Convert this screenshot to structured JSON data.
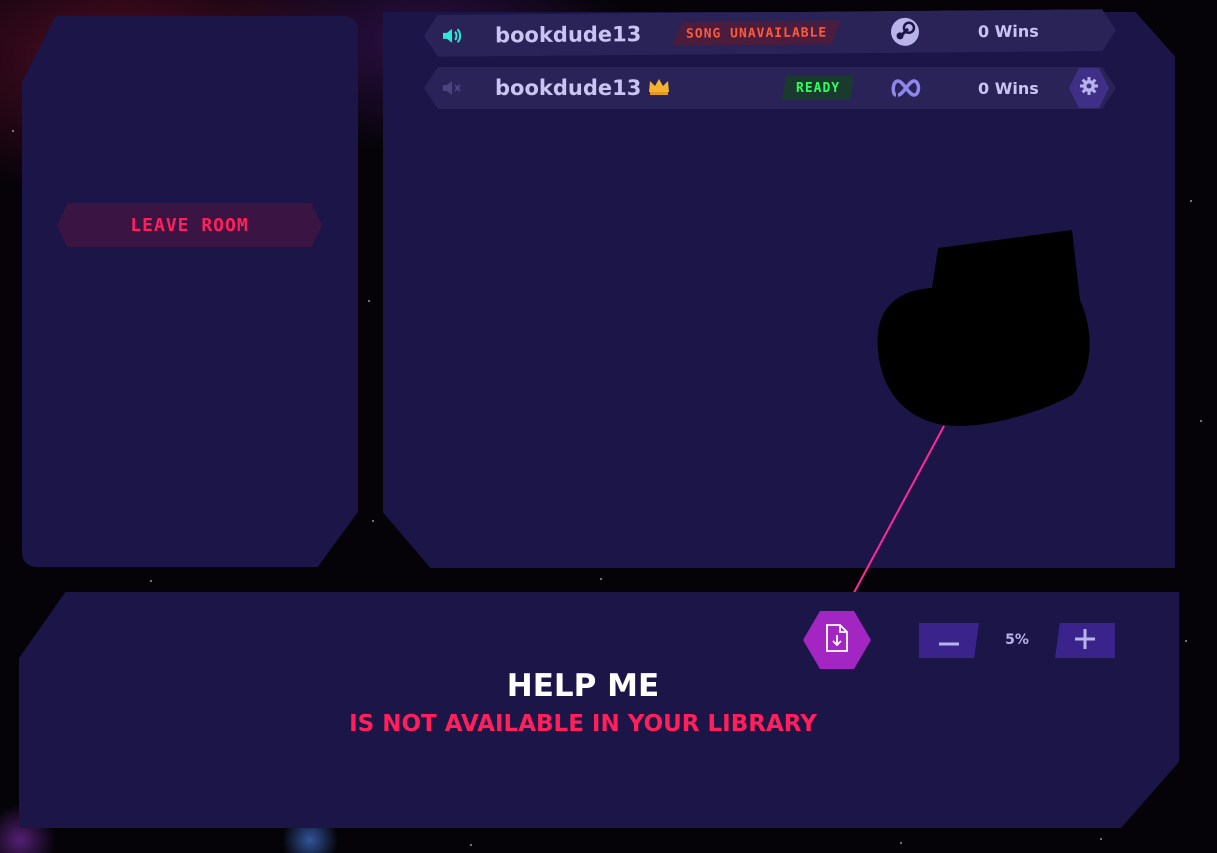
{
  "left_panel": {
    "leave_room_label": "LEAVE ROOM"
  },
  "players": [
    {
      "name": "bookdude13",
      "status": "SONG UNAVAILABLE",
      "status_color": "#ff5a3c",
      "audio": "speaker-on-icon",
      "platform": "steam-icon",
      "wins": "0 Wins",
      "host": false
    },
    {
      "name": "bookdude13",
      "status": "READY",
      "status_color": "#2cff5a",
      "audio": "speaker-muted-icon",
      "platform": "meta-icon",
      "wins": "0 Wins",
      "host": true,
      "host_icon": "crown-icon",
      "settings_icon": "gear-icon"
    }
  ],
  "bottom_panel": {
    "download_icon": "file-download-icon",
    "volume": {
      "value": "5%",
      "minus_icon": "minus-icon",
      "plus_icon": "plus-icon"
    },
    "song_title": "HELP ME",
    "song_message": "IS NOT AVAILABLE IN YOUR LIBRARY"
  },
  "colors": {
    "panel": "#1c1548",
    "accent_red": "#ff1f5a",
    "accent_magenta": "#a326c2",
    "laser": "#ff2a9a"
  }
}
